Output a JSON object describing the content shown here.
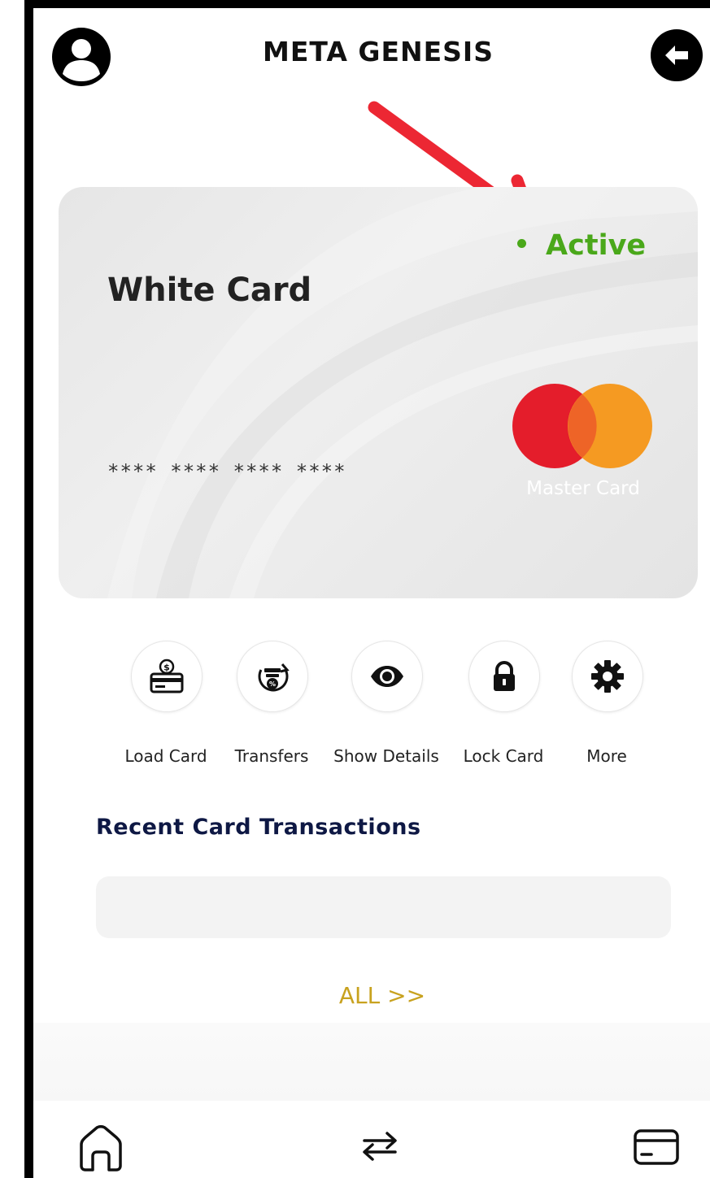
{
  "header": {
    "title": "META GENESIS",
    "profile_icon": "user-profile-icon",
    "back_icon": "arrow-left-circle-icon"
  },
  "card": {
    "name": "White Card",
    "number_masked": "**** **** **** ****",
    "status": "Active",
    "status_color": "#4aa81a",
    "brand_label": "Master Card",
    "brand_colors": [
      "#e41d2b",
      "#f59a22"
    ]
  },
  "annotation": {
    "arrow_color": "#ec2733"
  },
  "actions": [
    {
      "label": "Load Card",
      "icon": "load-card-icon"
    },
    {
      "label": "Transfers",
      "icon": "transfers-icon"
    },
    {
      "label": "Show Details",
      "icon": "eye-icon"
    },
    {
      "label": "Lock Card",
      "icon": "lock-icon"
    },
    {
      "label": "More",
      "icon": "gear-icon"
    }
  ],
  "transactions": {
    "title": "Recent Card Transactions",
    "all_link": "ALL >>"
  },
  "tabbar": [
    {
      "icon": "home-icon"
    },
    {
      "icon": "transfer-arrows-icon"
    },
    {
      "icon": "card-icon"
    }
  ]
}
